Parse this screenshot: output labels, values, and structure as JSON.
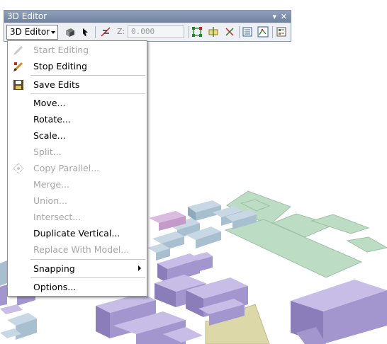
{
  "toolbar": {
    "title": "3D Editor",
    "pin_glyph": "▾",
    "close_glyph": "✕",
    "menu_button_label": "3D Editor",
    "z_label": "Z:",
    "z_value": "0.000"
  },
  "menu": {
    "items": [
      {
        "label": "Start Editing",
        "enabled": false,
        "icon": "pencil-icon"
      },
      {
        "label": "Stop Editing",
        "enabled": true,
        "icon": "stop-editing-icon"
      },
      {
        "label": "Save Edits",
        "enabled": true,
        "icon": "save-icon"
      },
      {
        "label": "Move...",
        "enabled": true
      },
      {
        "label": "Rotate...",
        "enabled": true
      },
      {
        "label": "Scale...",
        "enabled": true
      },
      {
        "label": "Split...",
        "enabled": false
      },
      {
        "label": "Copy Parallel...",
        "enabled": false,
        "icon": "copy-parallel-icon"
      },
      {
        "label": "Merge...",
        "enabled": false
      },
      {
        "label": "Union...",
        "enabled": false
      },
      {
        "label": "Intersect...",
        "enabled": false
      },
      {
        "label": "Duplicate Vertical...",
        "enabled": true
      },
      {
        "label": "Replace With Model...",
        "enabled": false
      },
      {
        "label": "Snapping",
        "enabled": true,
        "submenu": true
      },
      {
        "label": "Options...",
        "enabled": true
      }
    ]
  },
  "colors": {
    "building_purple": "#b2a5d6",
    "building_blue": "#b3c9d9",
    "parcel_green": "#bcdcc4",
    "parcel_yellow": "#dcd8a8",
    "building_pink": "#d0a8d4"
  }
}
